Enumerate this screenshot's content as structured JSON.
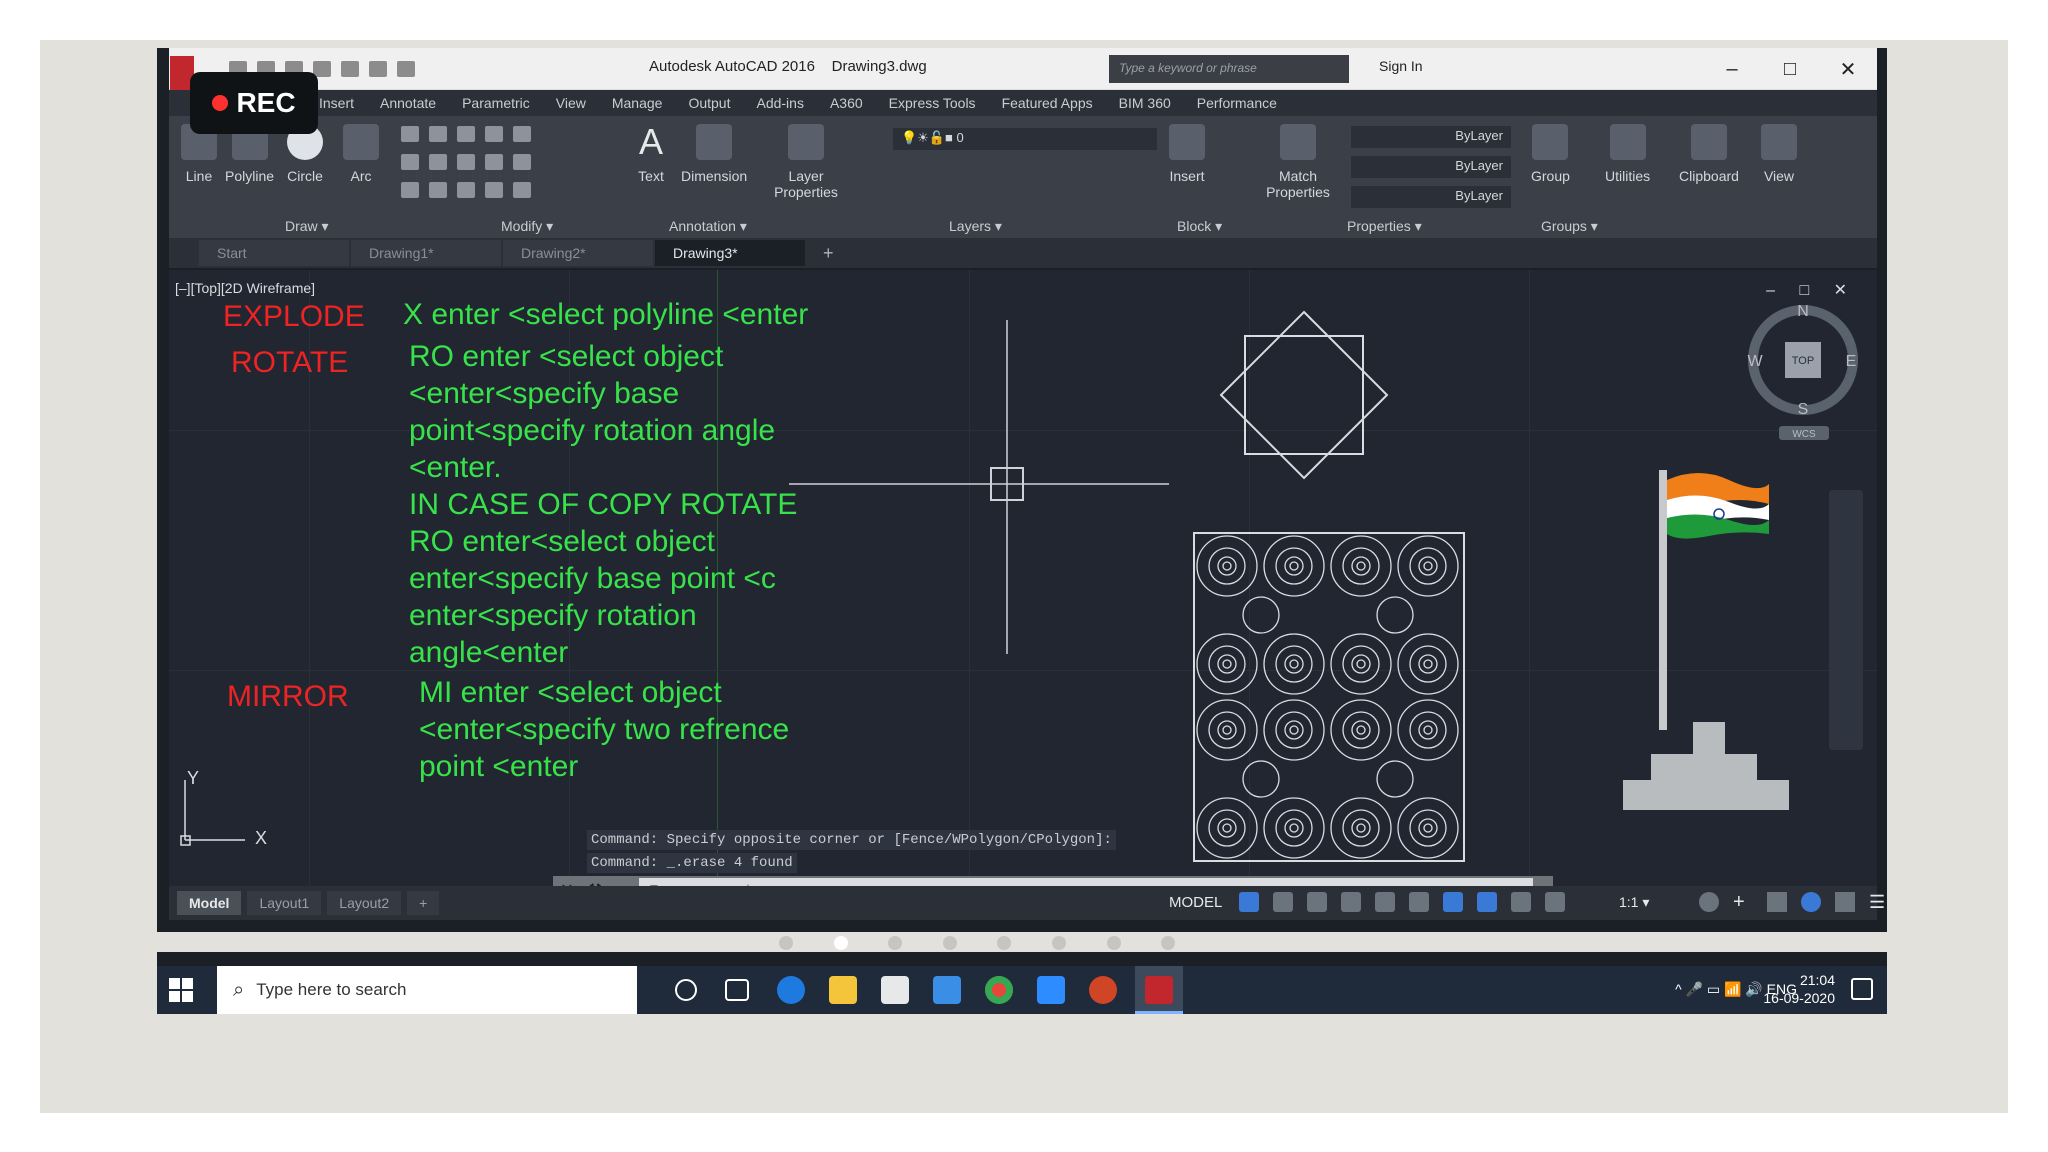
{
  "window": {
    "title": "Autodesk AutoCAD 2016    Drawing3.dwg",
    "search_placeholder": "Type a keyword or phrase",
    "signin": "Sign In",
    "controls": [
      "–",
      "□",
      "✕"
    ]
  },
  "recording": {
    "label": "REC"
  },
  "ribbon": {
    "tabs": [
      "Insert",
      "Annotate",
      "Parametric",
      "View",
      "Manage",
      "Output",
      "Add-ins",
      "A360",
      "Express Tools",
      "Featured Apps",
      "BIM 360",
      "Performance"
    ],
    "tools": {
      "line": "Line",
      "polyline": "Polyline",
      "circle": "Circle",
      "arc": "Arc",
      "text": "Text",
      "dimension": "Dimension",
      "layer_properties": "Layer Properties",
      "insert": "Insert",
      "match_properties": "Match Properties",
      "group": "Group",
      "utilities": "Utilities",
      "clipboard": "Clipboard",
      "view": "View"
    },
    "groups": {
      "draw": "Draw ▾",
      "modify": "Modify ▾",
      "annotation": "Annotation ▾",
      "layers": "Layers ▾",
      "block": "Block ▾",
      "properties": "Properties ▾",
      "groups": "Groups ▾"
    },
    "layer_value": "0",
    "bylayer": [
      "ByLayer",
      "ByLayer",
      "ByLayer"
    ]
  },
  "doc_tabs": [
    {
      "label": "Start",
      "active": false
    },
    {
      "label": "Drawing1*",
      "active": false
    },
    {
      "label": "Drawing2*",
      "active": false
    },
    {
      "label": "Drawing3*",
      "active": true
    }
  ],
  "viewport": {
    "label": "[–][Top][2D Wireframe]",
    "controls": "– □ ✕"
  },
  "instructions": [
    {
      "command": "EXPLODE",
      "lines": [
        "X enter <select polyline <enter"
      ]
    },
    {
      "command": "ROTATE",
      "lines": [
        "RO enter <select object",
        "<enter<specify base",
        "point<specify rotation angle",
        "<enter.",
        "IN CASE OF COPY ROTATE",
        "RO enter<select object",
        "enter<specify base point <c",
        "enter<specify rotation",
        "angle<enter"
      ]
    },
    {
      "command": "MIRROR",
      "lines": [
        "MI enter <select object",
        "<enter<specify two refrence",
        "point <enter"
      ]
    }
  ],
  "navcube": {
    "n": "N",
    "s": "S",
    "e": "E",
    "w": "W",
    "top": "TOP",
    "wcs": "WCS"
  },
  "ucs": {
    "x": "X",
    "y": "Y"
  },
  "command_history": [
    "Command: Specify opposite corner or [Fence/WPolygon/CPolygon]:",
    "Command: _.erase 4 found"
  ],
  "command_line": {
    "placeholder": "Type a command",
    "prompt": "▸•"
  },
  "layout_tabs": [
    {
      "label": "Model",
      "active": true
    },
    {
      "label": "Layout1",
      "active": false
    },
    {
      "label": "Layout2",
      "active": false
    },
    {
      "label": "+",
      "active": false
    }
  ],
  "status": {
    "model": "MODEL",
    "scale": "1:1 ▾"
  },
  "taskbar": {
    "search_placeholder": "Type here to search",
    "tray": "^ 🎤 ▭ ENG",
    "lang": "ENG",
    "time": "21:04",
    "date": "16-09-2020"
  },
  "colors": {
    "command_green": "#38e24a",
    "command_red": "#ee2323",
    "viewport_bg": "#212630"
  }
}
